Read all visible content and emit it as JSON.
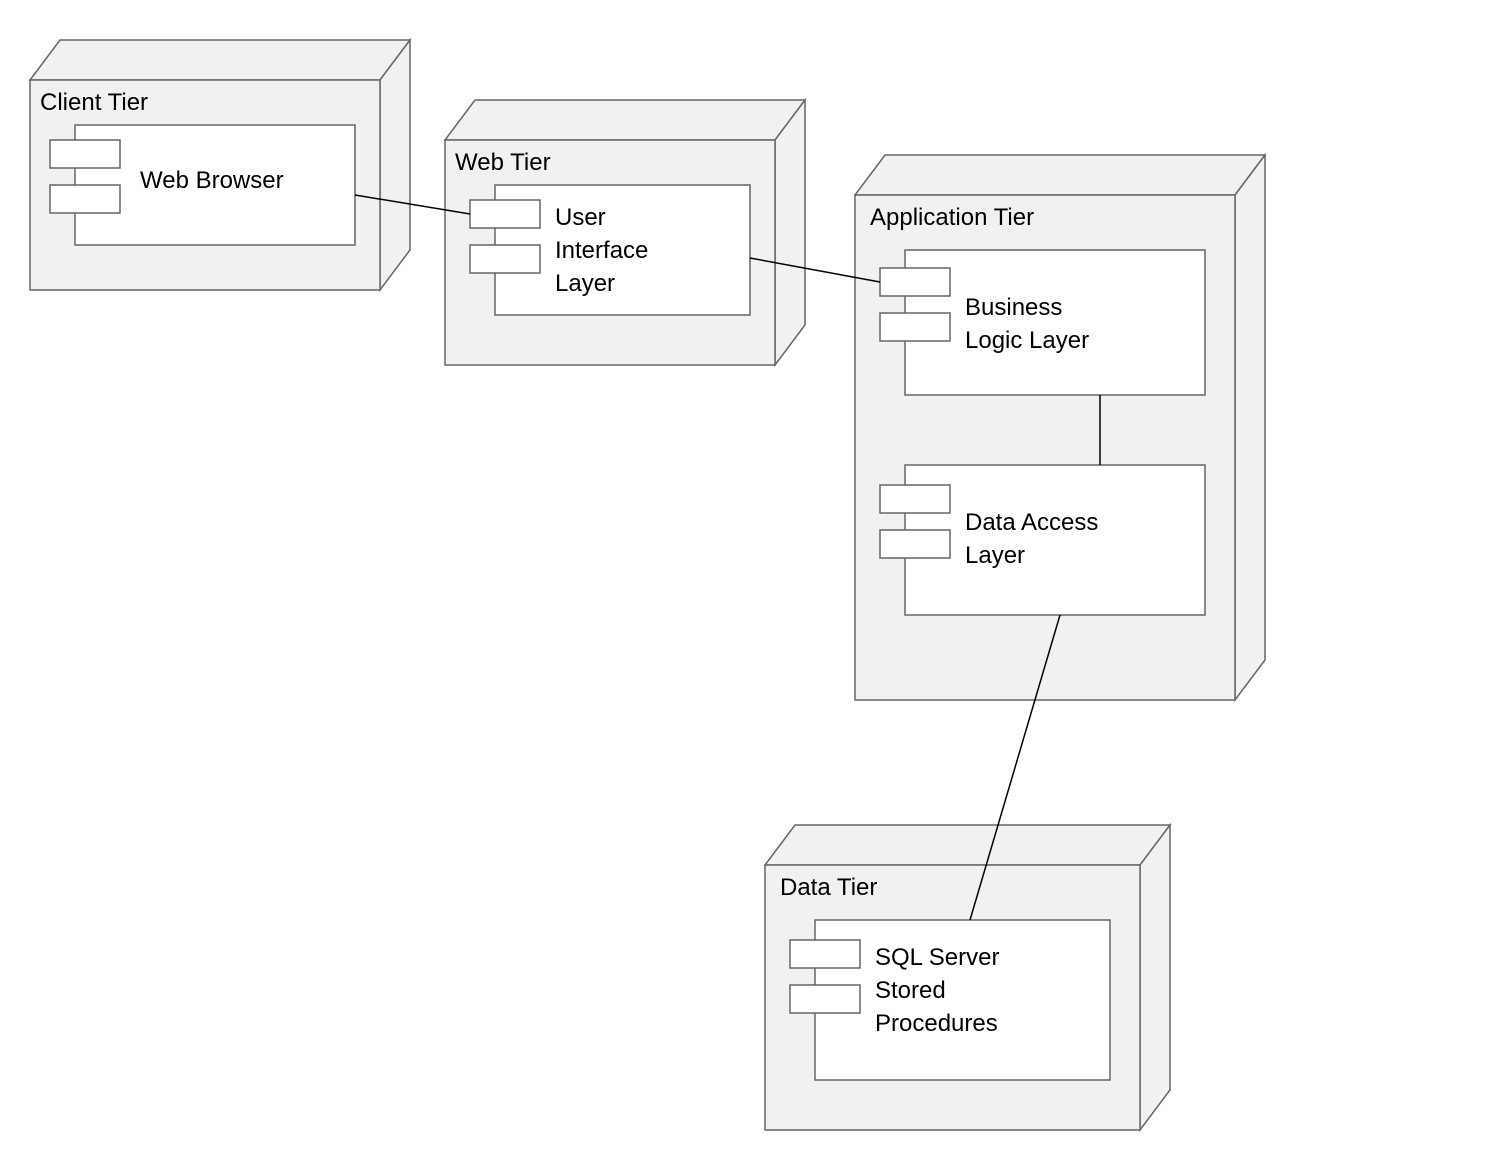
{
  "nodes": {
    "client": {
      "title": "Client Tier",
      "component": "Web Browser"
    },
    "web": {
      "title": "Web Tier",
      "component_line1": "User",
      "component_line2": "Interface",
      "component_line3": "Layer"
    },
    "app": {
      "title": "Application Tier",
      "component1_line1": "Business",
      "component1_line2": "Logic Layer",
      "component2_line1": "Data Access",
      "component2_line2": "Layer"
    },
    "data": {
      "title": "Data Tier",
      "component_line1": "SQL Server",
      "component_line2": "Stored",
      "component_line3": "Procedures"
    }
  },
  "colors": {
    "nodeFill": "#f1f1f1",
    "componentFill": "#ffffff",
    "stroke": "#000000"
  }
}
